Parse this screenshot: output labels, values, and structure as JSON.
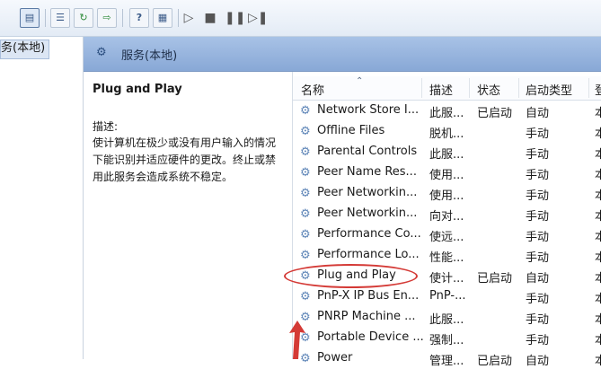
{
  "toolbar": {
    "icons": [
      "pane-icon",
      "list-view-icon",
      "refresh-icon",
      "export-icon",
      "help-icon",
      "properties-icon",
      "play-icon",
      "stop-icon",
      "pause-icon",
      "restart-icon"
    ]
  },
  "tree": {
    "selected_item": "务(本地)"
  },
  "banner": {
    "title": "服务(本地)"
  },
  "details": {
    "service_name": "Plug and Play",
    "description_label": "描述:",
    "description": "使计算机在极少或没有用户输入的情况下能识别并适应硬件的更改。终止或禁用此服务会造成系统不稳定。"
  },
  "columns": {
    "name": "名称",
    "description": "描述",
    "status": "状态",
    "startup": "启动类型",
    "extra": "登"
  },
  "services": [
    {
      "name": "Network Store I...",
      "description": "此服...",
      "status": "已启动",
      "startup": "自动",
      "extra": "本"
    },
    {
      "name": "Offline Files",
      "description": "脱机...",
      "status": "",
      "startup": "手动",
      "extra": "本"
    },
    {
      "name": "Parental Controls",
      "description": "此服...",
      "status": "",
      "startup": "手动",
      "extra": "本"
    },
    {
      "name": "Peer Name Res...",
      "description": "使用...",
      "status": "",
      "startup": "手动",
      "extra": "本"
    },
    {
      "name": "Peer Networkin...",
      "description": "使用...",
      "status": "",
      "startup": "手动",
      "extra": "本"
    },
    {
      "name": "Peer Networkin...",
      "description": "向对...",
      "status": "",
      "startup": "手动",
      "extra": "本"
    },
    {
      "name": "Performance Co...",
      "description": "使远...",
      "status": "",
      "startup": "手动",
      "extra": "本"
    },
    {
      "name": "Performance Lo...",
      "description": "性能...",
      "status": "",
      "startup": "手动",
      "extra": "本"
    },
    {
      "name": "Plug and Play",
      "description": "使计...",
      "status": "已启动",
      "startup": "自动",
      "extra": "本"
    },
    {
      "name": "PnP-X IP Bus En...",
      "description": "PnP-...",
      "status": "",
      "startup": "手动",
      "extra": "本"
    },
    {
      "name": "PNRP Machine ...",
      "description": "此服...",
      "status": "",
      "startup": "手动",
      "extra": "本"
    },
    {
      "name": "Portable Device ...",
      "description": "强制...",
      "status": "",
      "startup": "手动",
      "extra": "本"
    },
    {
      "name": "Power",
      "description": "管理...",
      "status": "已启动",
      "startup": "自动",
      "extra": "本"
    }
  ],
  "colors": {
    "annotation": "#d43a36",
    "banner": "#95b3dd"
  }
}
